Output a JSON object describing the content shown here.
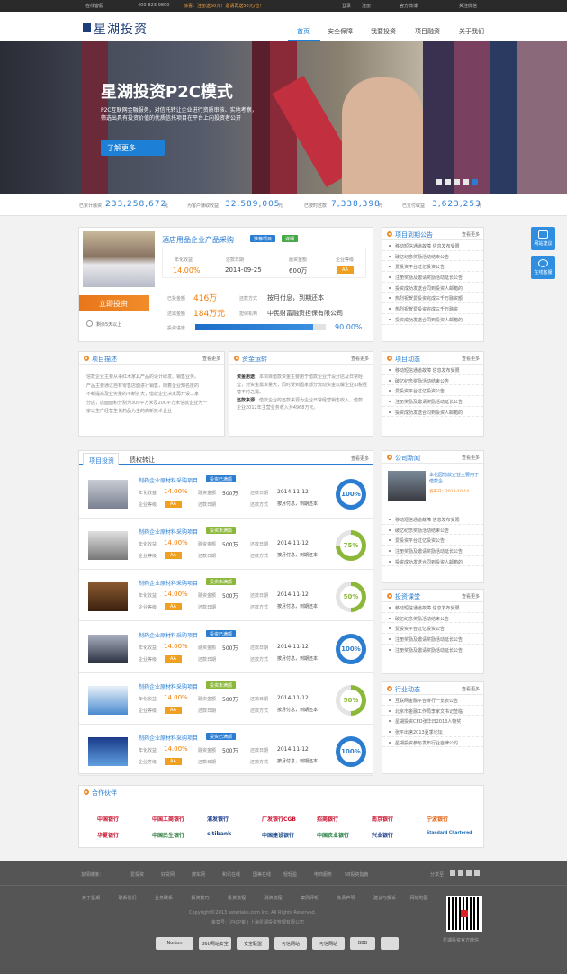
{
  "topbar": {
    "online": "在线客服",
    "phone": "400-823-9800",
    "promo": "惊喜：注册送50元！邀请再送50元/位！",
    "login": "登录",
    "register": "注册",
    "weibo": "官方微博",
    "wechat": "关注微信"
  },
  "brand": {
    "name": "星湖投资"
  },
  "nav": {
    "items": [
      "首页",
      "安全保障",
      "我要投资",
      "项目融资",
      "关于我们"
    ]
  },
  "banner": {
    "title": "星湖投资P2C模式",
    "line1": "P2C互联网金融服务，对信托转让企业进行资质审核、实地考察，",
    "line2": "筛选出具有投资价值的优质信托项目在平台上向投资者公开",
    "button": "了解更多"
  },
  "stats": [
    {
      "label": "已累计融资",
      "value": "233,258,672",
      "unit": "元"
    },
    {
      "label": "为客户赚取收益",
      "value": "32,589,005",
      "unit": "元"
    },
    {
      "label": "已按时还款",
      "value": "7,338,398",
      "unit": "元"
    },
    {
      "label": "已支付收益",
      "value": "3,623,253",
      "unit": "元"
    }
  ],
  "featured": {
    "title": "酒店用品企业产品采购",
    "tag1": "推荐项目",
    "tag2": "详细",
    "rate_label": "年化收益",
    "rate": "14.00%",
    "date_label": "还款日期",
    "date": "2014-09-25",
    "amount_label": "融资金额",
    "amount": "600万",
    "grade_label": "企业等级",
    "grade": "AA",
    "invest_btn": "立即投资",
    "time_left": "剩余5天以上",
    "raised_label": "已投金额",
    "raised": "416万",
    "remain_label": "还需金额",
    "remain": "184万元",
    "method_label": "还款方式",
    "method": "按月付息，到期还本",
    "guarantor_label": "担保机构",
    "guarantor": "中民财富融资担保有限公司",
    "progress_label": "投资进度",
    "progress": "90.00%",
    "progress_value": 0.9
  },
  "desc": {
    "title": "项目描述",
    "more": "查看更多",
    "text": [
      "信款企业主要从事红木家具产品的设计研发、销售业务。",
      "产品主要通过自有零售店面进行销售，随着企业知名度的",
      "不断提高及业务量的不断扩大，借款企业决定再开设二家",
      "分店，店面面积分别为300平方米及200平方米信款企业为一",
      "家以生产经营生化药品为主的高新技术企业"
    ]
  },
  "funds": {
    "title": "资金运转",
    "more": "查看更多",
    "use_label": "资金用途：",
    "use": "本项目借款资金主要用于借款企业开设分店及日常经营，对资金需求量大，同时受到国家部分流动资金以解企业扣税经营不时之需。",
    "source_label": "还款来源：",
    "source": "借款企业的还款来源为企业日常经营销售收入，借款企业2012年主营业务收入为4968万元。"
  },
  "notice": {
    "title": "项目到期公告",
    "more": "查看更多",
    "items": [
      "移动短信通道故障 信息发布受限",
      "破亿纪念奖励活动结束公告",
      "爱投资平台过亿投资公告",
      "注册奖励及邀请奖励活动延长公告",
      "投资成功发送合同到投资人邮箱的",
      "热烈祝贺爱投资完成三千万融资额",
      "热烈祝贺爱投资完成三千万融资",
      "投资成功发送合同到投资人邮箱的"
    ]
  },
  "dynamic": {
    "title": "项目动态",
    "more": "查看更多",
    "items": [
      "移动短信通道故障 信息发布受限",
      "破亿纪念奖励活动结束公告",
      "爱投资平台过亿投资公告",
      "注册奖励及邀请奖励活动延长公告",
      "投资成功发送合同到投资人邮箱的"
    ]
  },
  "tabs": {
    "active": "项目投资",
    "other": "债权转让",
    "more": "查看更多"
  },
  "projects": [
    {
      "name": "制药企业原材料采购项目",
      "status": "投资已满额",
      "status_color": "#2a7dd1",
      "rate": "14.00%",
      "grade": "AA",
      "amount": "500万",
      "date": "2014-11-12",
      "method": "按月付息，到期还本",
      "pct": "100%",
      "pct_value": 1.0
    },
    {
      "name": "制药企业原材料采购项目",
      "status": "投资未满额",
      "status_color": "#8cb83a",
      "rate": "14.00%",
      "grade": "AA",
      "amount": "500万",
      "date": "2014-11-12",
      "method": "按月付息，到期还本",
      "pct": "75%",
      "pct_value": 0.75
    },
    {
      "name": "制药企业原材料采购项目",
      "status": "投资未满额",
      "status_color": "#8cb83a",
      "rate": "14.00%",
      "grade": "AA",
      "amount": "500万",
      "date": "2014-11-12",
      "method": "按月付息，到期还本",
      "pct": "50%",
      "pct_value": 0.5
    },
    {
      "name": "制药企业原材料采购项目",
      "status": "投资已满额",
      "status_color": "#2a7dd1",
      "rate": "14.00%",
      "grade": "AA",
      "amount": "500万",
      "date": "2014-11-12",
      "method": "按月付息，到期还本",
      "pct": "100%",
      "pct_value": 1.0
    },
    {
      "name": "制药企业原材料采购项目",
      "status": "投资未满额",
      "status_color": "#8cb83a",
      "rate": "14.00%",
      "grade": "AA",
      "amount": "500万",
      "date": "2014-11-12",
      "method": "按月付息，到期还本",
      "pct": "50%",
      "pct_value": 0.5
    },
    {
      "name": "制药企业原材料采购项目",
      "status": "投资已满额",
      "status_color": "#2a7dd1",
      "rate": "14.00%",
      "grade": "AA",
      "amount": "500万",
      "date": "2014-11-12",
      "method": "按月付息，到期还本",
      "pct": "100%",
      "pct_value": 1.0
    }
  ],
  "labels": {
    "rate": "年化收益",
    "grade": "企业等级",
    "amount": "融资金额",
    "date": "还款日期",
    "method": "还款方式"
  },
  "news": {
    "title": "公司新闻",
    "more": "查看更多",
    "headline": "本花园借款企业主要用于借款企",
    "date": "发布日：2013-10-14",
    "items": [
      "移动短信通道故障 信息发布受限",
      "破亿纪念奖励活动结束公告",
      "爱投资平台过亿投资公告",
      "注册奖励及邀请奖励活动延长公告",
      "投资成功发送合同到投资人邮箱的"
    ]
  },
  "course": {
    "title": "投资课堂",
    "more": "查看更多",
    "items": [
      "移动短信通道故障 信息发布受限",
      "破亿纪念奖励活动结束公告",
      "爱投资平台过亿投资公告",
      "注册奖励及邀请奖励活动延长公告",
      "注册奖励及邀请奖励活动延长公告"
    ]
  },
  "industry": {
    "title": "行业动态",
    "more": "查看更多",
    "items": [
      "互联网金融平台排行一览表公告",
      "北京市金融工作局李家文书记莅临",
      "星湖投资CEO张华日2013人物奖",
      "张平出席2013夏季论坛",
      "星湖投资参与发布行业自律公约"
    ]
  },
  "partners": {
    "title": "合作伙伴",
    "row1": [
      "中国银行",
      "中国工商银行",
      "浦发银行",
      "广发银行CGB",
      "招商银行",
      "南京银行",
      "宁波银行"
    ],
    "row2": [
      "华夏银行",
      "中国民生银行",
      "citibank",
      "中国建设银行",
      "中国农业银行",
      "兴业银行",
      "Standard Chartered"
    ]
  },
  "footer": {
    "links_label": "友情链接：",
    "links": [
      "爱投资",
      "好贷网",
      "搜车网",
      "和讯在线",
      "国美在线",
      "轻轻盈",
      "电商服务",
      "58投资指南"
    ],
    "share_label": "分享至：",
    "links2": [
      "关于星湖",
      "联系我们",
      "业务联系",
      "投资技巧",
      "投资流程",
      "融资流程",
      "案例评析",
      "免责声明",
      "建议与投诉",
      "网站地图"
    ],
    "copyright": "Copyright©2013 asterlake.com Inc. All Rights Reserved.",
    "icp": "备案号：沪ICP备  |  上海星湖投资管理有限公司",
    "badges": [
      "Norton",
      "360网站安全",
      "安全联盟",
      "可信网站",
      "可信网站",
      "BBB",
      ""
    ],
    "qr_label": "星湖投资官方微信"
  },
  "float": {
    "advice": "网站建议",
    "service": "在线客服"
  }
}
